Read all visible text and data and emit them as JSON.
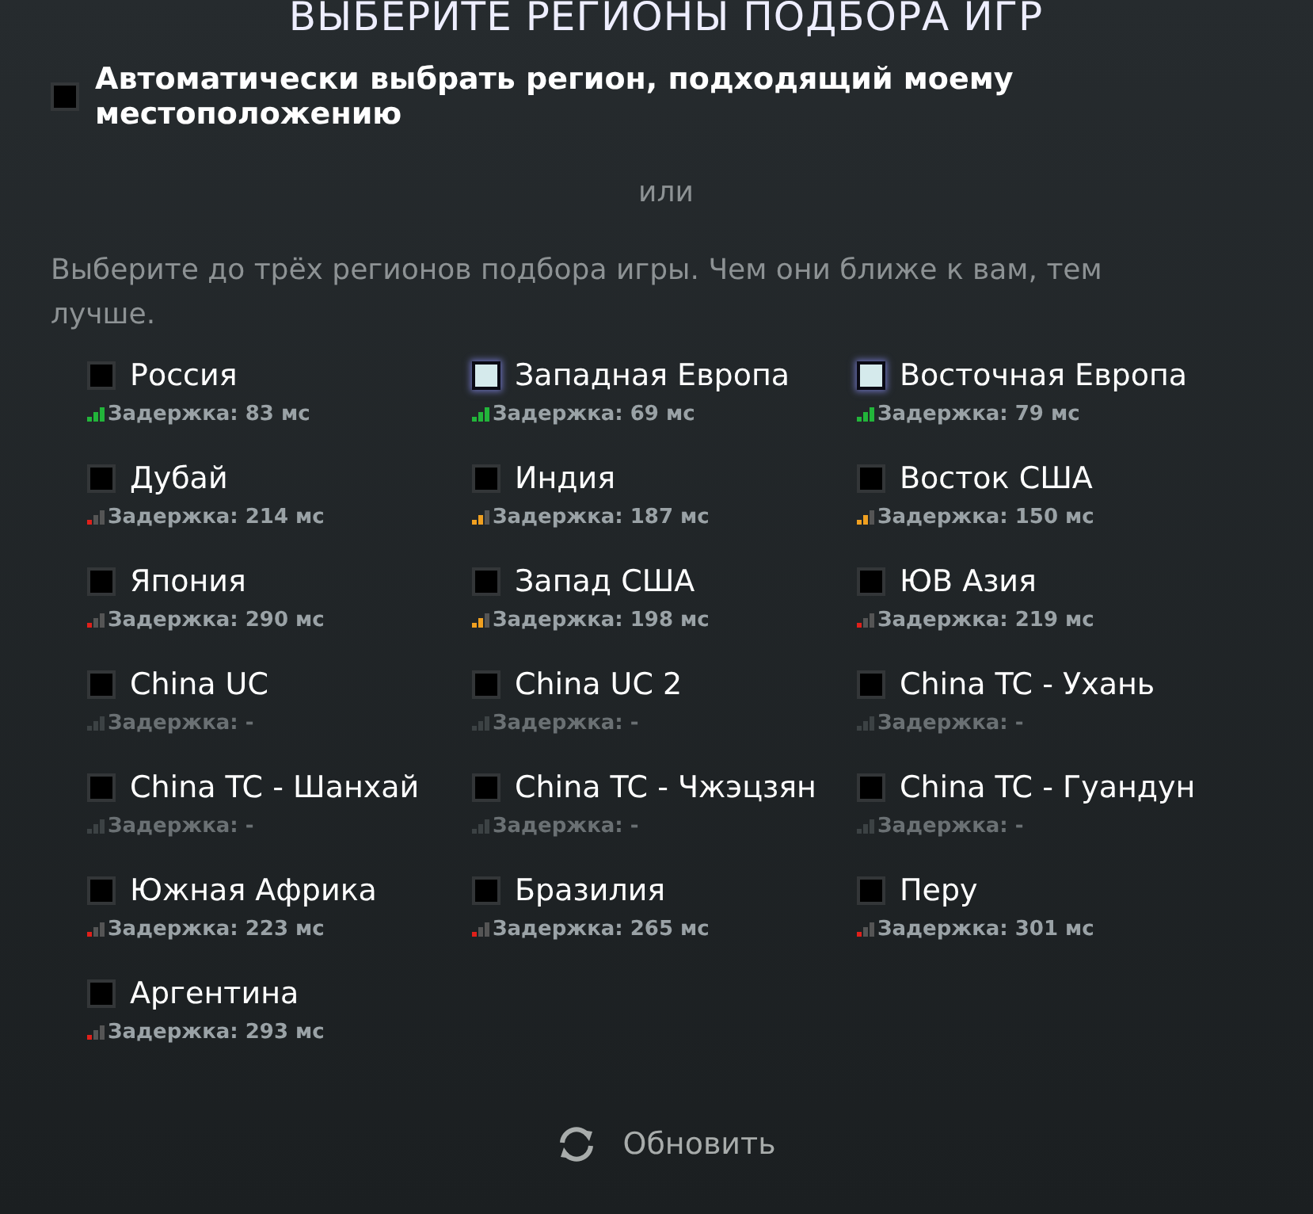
{
  "title": "ВЫБЕРИТЕ РЕГИОНЫ ПОДБОРА ИГР",
  "auto": {
    "label": "Автоматически выбрать регион, подходящий моему местоположению",
    "checked": false
  },
  "separator": "или",
  "hint": "Выберите до трёх регионов подбора игры. Чем они ближе к вам, тем лучше.",
  "regions": [
    {
      "name": "Россия",
      "checked": false,
      "kind": "good",
      "latency": "Задержка: 83 мс"
    },
    {
      "name": "Западная Европа",
      "checked": true,
      "kind": "good",
      "latency": "Задержка: 69 мс"
    },
    {
      "name": "Восточная Европа",
      "checked": true,
      "kind": "good",
      "latency": "Задержка: 79 мс"
    },
    {
      "name": "Дубай",
      "checked": false,
      "kind": "poor",
      "latency": "Задержка: 214 мс"
    },
    {
      "name": "Индия",
      "checked": false,
      "kind": "fair",
      "latency": "Задержка: 187 мс"
    },
    {
      "name": "Восток США",
      "checked": false,
      "kind": "fair",
      "latency": "Задержка: 150 мс"
    },
    {
      "name": "Япония",
      "checked": false,
      "kind": "poor",
      "latency": "Задержка: 290 мс"
    },
    {
      "name": "Запад США",
      "checked": false,
      "kind": "fair",
      "latency": "Задержка: 198 мс"
    },
    {
      "name": "ЮВ Азия",
      "checked": false,
      "kind": "poor",
      "latency": "Задержка: 219 мс"
    },
    {
      "name": "China UC",
      "checked": false,
      "kind": "none",
      "latency": "Задержка: -"
    },
    {
      "name": "China UC 2",
      "checked": false,
      "kind": "none",
      "latency": "Задержка: -"
    },
    {
      "name": "China TC - Ухань",
      "checked": false,
      "kind": "none",
      "latency": "Задержка: -"
    },
    {
      "name": "China TC - Шанхай",
      "checked": false,
      "kind": "none",
      "latency": "Задержка: -"
    },
    {
      "name": "China TC - Чжэцзян",
      "checked": false,
      "kind": "none",
      "latency": "Задержка: -"
    },
    {
      "name": "China TC - Гуандун",
      "checked": false,
      "kind": "none",
      "latency": "Задержка: -"
    },
    {
      "name": "Южная Африка",
      "checked": false,
      "kind": "poor",
      "latency": "Задержка: 223 мс"
    },
    {
      "name": "Бразилия",
      "checked": false,
      "kind": "poor",
      "latency": "Задержка: 265 мс"
    },
    {
      "name": "Перу",
      "checked": false,
      "kind": "poor",
      "latency": "Задержка: 301 мс"
    },
    {
      "name": "Аргентина",
      "checked": false,
      "kind": "poor",
      "latency": "Задержка: 293 мс"
    }
  ],
  "refresh_button": "Обновить"
}
